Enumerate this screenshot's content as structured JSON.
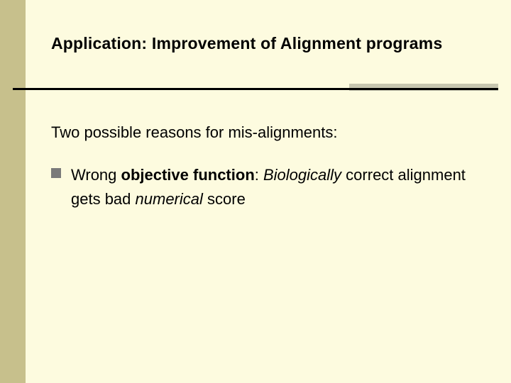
{
  "slide": {
    "title": "Application: Improvement of Alignment programs",
    "intro": "Two possible reasons for mis-alignments:",
    "bullet": {
      "lead": "Wrong ",
      "obj_func": "objective function",
      "colon": ": ",
      "bio_it": "Biologically",
      "after_bio": " correct alignment gets bad ",
      "num_it": "numerical",
      "tail": " score"
    }
  },
  "colors": {
    "background": "#fdfbdf",
    "left_band": "#c7c08c",
    "bullet_square": "#7a7a7a",
    "rule": "#000000"
  }
}
